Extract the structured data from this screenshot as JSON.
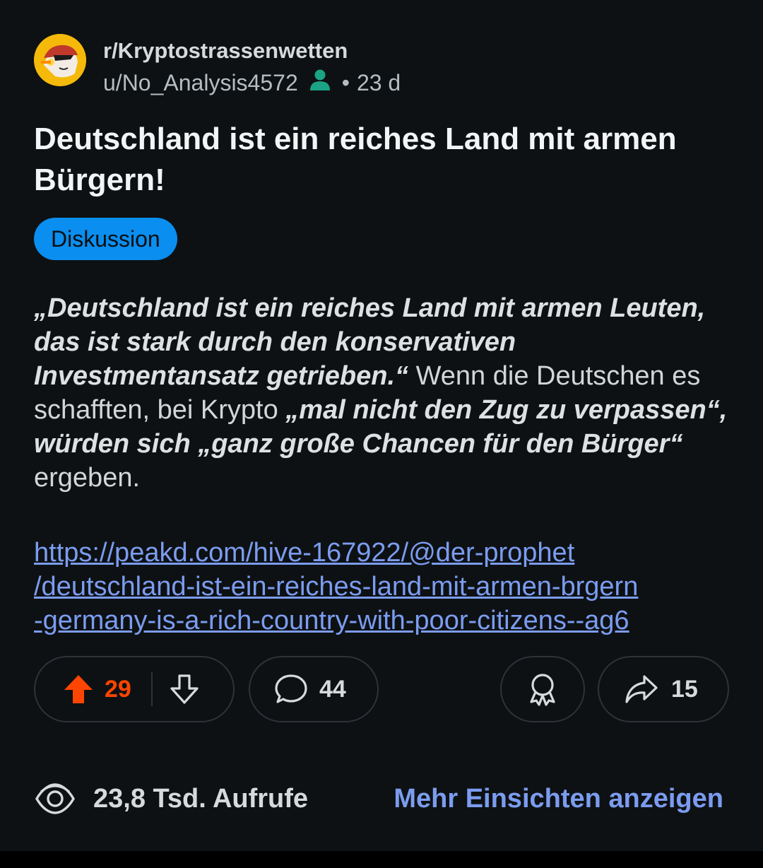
{
  "post": {
    "subreddit": "r/Kryptostrassenwetten",
    "username": "u/No_Analysis4572",
    "age": "23 d",
    "title": "Deutschland ist ein reiches Land mit armen Bürgern!",
    "flair": "Diskussion",
    "body": {
      "quote1": "„Deutschland ist ein reiches Land mit armen Leuten, das ist stark durch den konservativen Investmentansatz getrieben.“",
      "text1": " Wenn die Deutschen es schafften, bei Krypto ",
      "quote2": "„mal nicht den Zug zu verpassen“, würden sich „ganz große Chancen für den Bürger“",
      "text2": " ergeben."
    },
    "link": {
      "line1": "https://peakd.com/hive-167922/@der-prophet",
      "line2": "/deutschland-ist-ein-reiches-land-mit-armen-brgern",
      "line3": "-germany-is-a-rich-country-with-poor-citizens--ag6"
    }
  },
  "actions": {
    "upvotes": "29",
    "comments": "44",
    "shares": "15"
  },
  "insights": {
    "views": "23,8 Tsd. Aufrufe",
    "more_label": "Mehr Einsichten anzeigen"
  },
  "colors": {
    "background": "#0e1113",
    "upvote": "#ff4500",
    "flair": "#0a8eef",
    "link": "#7b9cf0",
    "online": "#1aa385"
  }
}
